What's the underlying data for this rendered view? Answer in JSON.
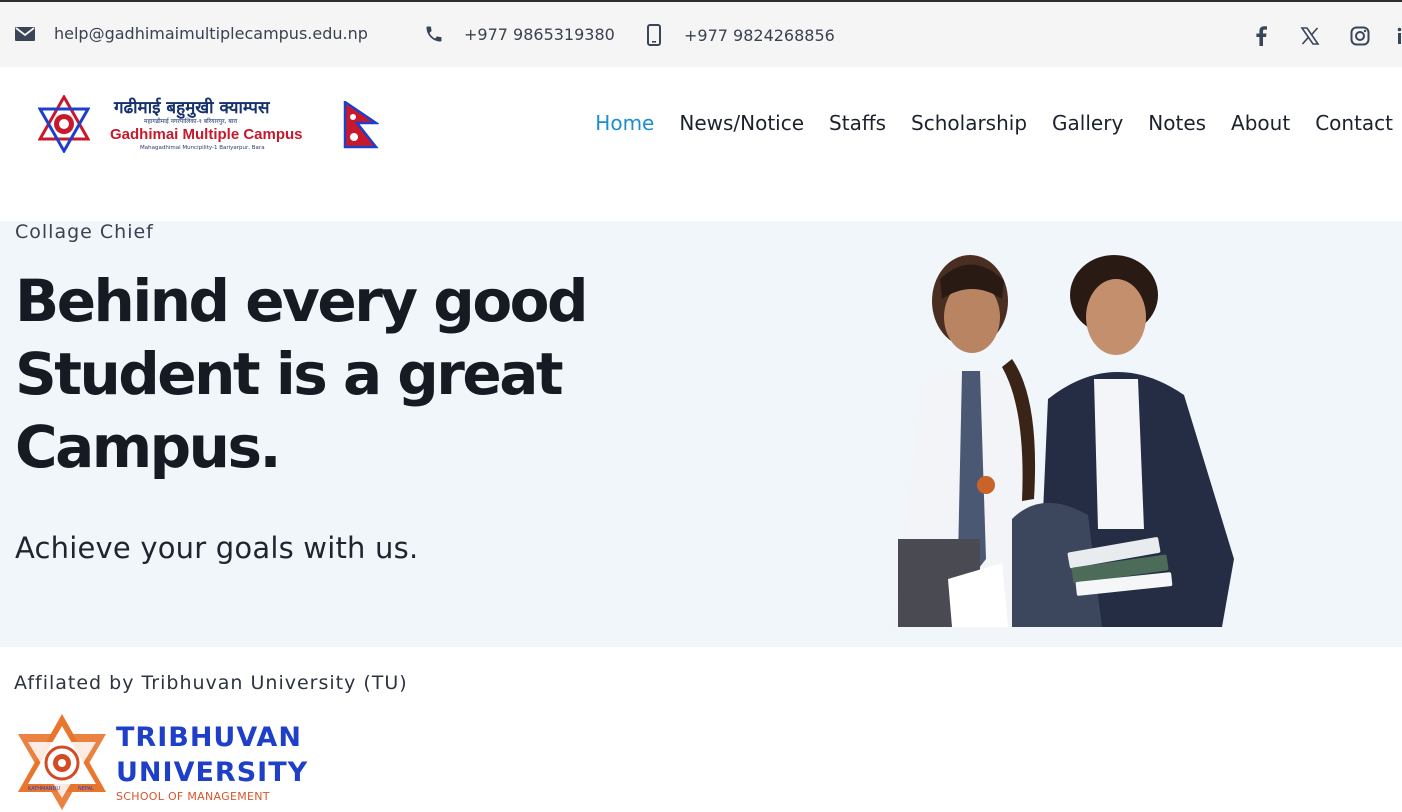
{
  "topbar": {
    "email": "help@gadhimaimultiplecampus.edu.np",
    "phone": "+977 9865319380",
    "mobile": "+977 9824268856",
    "social": [
      "facebook-icon",
      "x-icon",
      "instagram-icon"
    ]
  },
  "logo": {
    "name_np": "गढीमाई बहुमुखी क्याम्पस",
    "sub_np": "महागढीमाई नगरपालिका-१ बरियारपुर, बारा",
    "name_en": "Gadhimai Multiple Campus",
    "sub_en": "Mahagadhimai Muncipility-1 Bariyarpur, Bara"
  },
  "nav": {
    "items": [
      {
        "label": "Home",
        "active": true
      },
      {
        "label": "News/Notice",
        "active": false
      },
      {
        "label": "Staffs",
        "active": false
      },
      {
        "label": "Scholarship",
        "active": false
      },
      {
        "label": "Gallery",
        "active": false
      },
      {
        "label": "Notes",
        "active": false
      },
      {
        "label": "About",
        "active": false
      },
      {
        "label": "Contact",
        "active": false
      }
    ]
  },
  "hero": {
    "kicker": "Collage Chief",
    "title": "Behind every good Student is a great Campus.",
    "subtitle": "Achieve your goals with us."
  },
  "affiliation": {
    "text": "Affilated by Tribhuvan University (TU)",
    "tu_name_line1": "TRIBHUVAN",
    "tu_name_line2": "UNIVERSITY",
    "tu_school": "SCHOOL OF MANAGEMENT",
    "tu_ring_left": "KATHMANDU",
    "tu_ring_right": "NEPAL"
  },
  "colors": {
    "nav_active": "#1a8fd0",
    "hero_bg": "#f1f6fb",
    "tu_blue": "#1e3fc8",
    "tu_orange": "#e8762d",
    "brand_red": "#c8192c"
  }
}
